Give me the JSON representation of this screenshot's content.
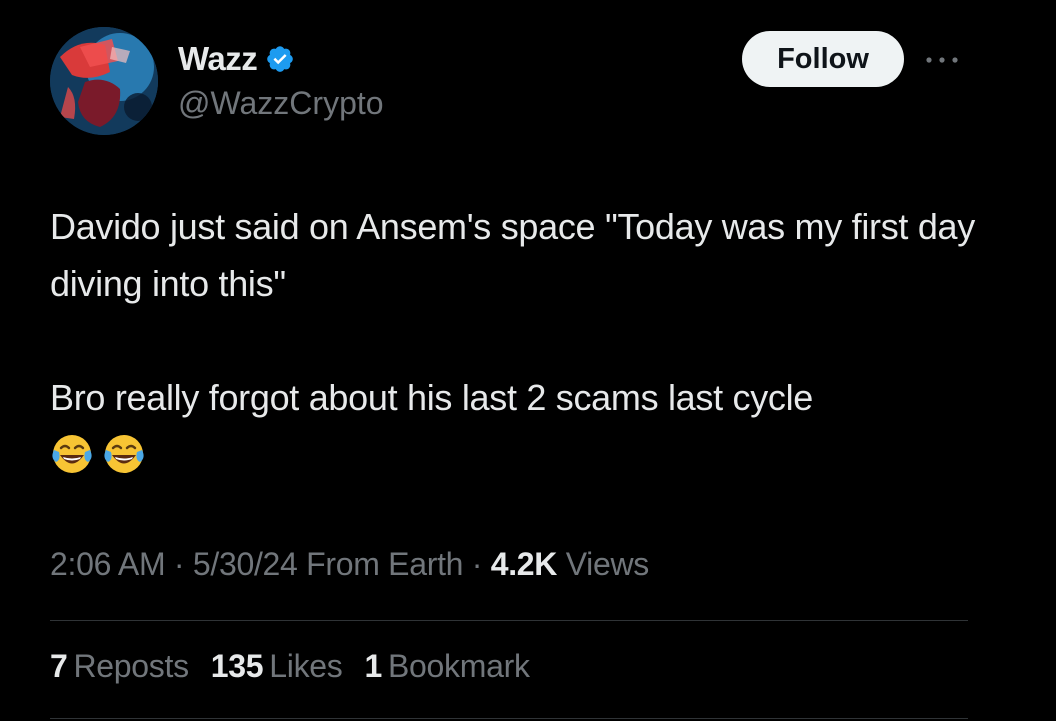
{
  "colors": {
    "background": "#000000",
    "text_primary": "#e7e9ea",
    "text_secondary": "#71767b",
    "verified_blue": "#1d9bf0",
    "follow_bg": "#eff3f4",
    "divider": "#2f3336"
  },
  "author": {
    "display_name": "Wazz",
    "handle": "@WazzCrypto",
    "verified_icon": "verified-badge-icon",
    "avatar_icon": "avatar"
  },
  "header": {
    "follow_label": "Follow",
    "more_icon": "more-options-icon"
  },
  "tweet": {
    "paragraphs": [
      "Davido just said on Ansem's space \"Today was my first day diving into this\"",
      "Bro really forgot about his last 2 scams last cycle"
    ],
    "emojis": [
      "😂",
      "😂"
    ]
  },
  "meta": {
    "time": "2:06 AM",
    "date": "5/30/24",
    "source": "From Earth",
    "views_count": "4.2K",
    "views_label": "Views",
    "separator": "·"
  },
  "stats": {
    "reposts_count": "7",
    "reposts_label": "Reposts",
    "likes_count": "135",
    "likes_label": "Likes",
    "bookmarks_count": "1",
    "bookmarks_label": "Bookmark"
  }
}
